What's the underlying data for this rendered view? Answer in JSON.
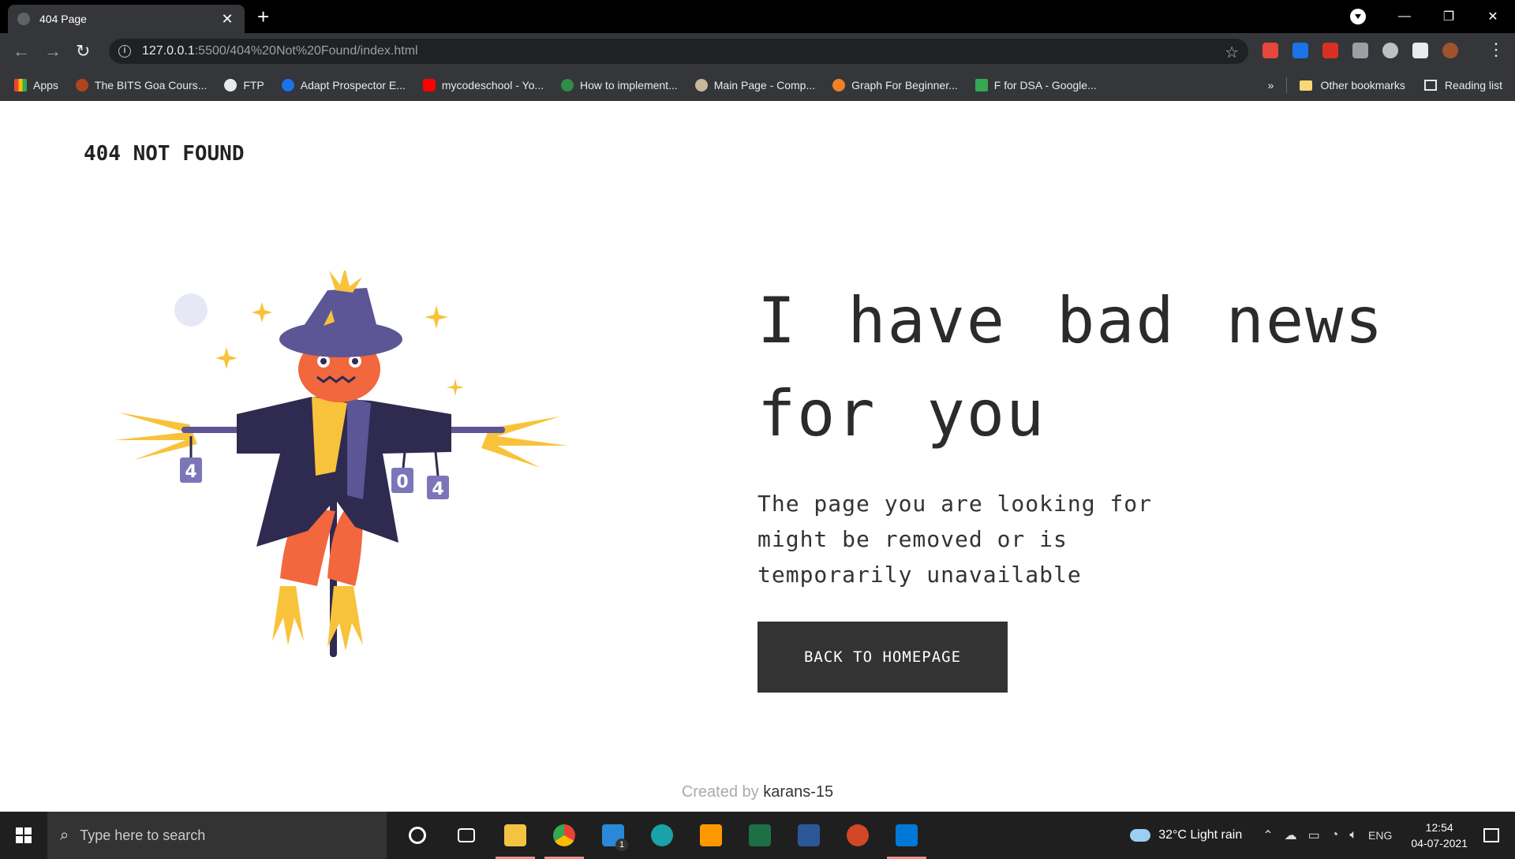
{
  "browser": {
    "tab_title": "404 Page",
    "tab_close": "✕",
    "new_tab": "+",
    "url_host": "127.0.0.1",
    "url_path": ":5500/404%20Not%20Found/index.html",
    "bookmarks": [
      {
        "label": "Apps",
        "color": "#ea4335"
      },
      {
        "label": "The BITS Goa Cours...",
        "color": "#b0441f"
      },
      {
        "label": "FTP",
        "color": "#e8eaed"
      },
      {
        "label": "Adapt Prospector E...",
        "color": "#1a73e8"
      },
      {
        "label": "mycodeschool - Yo...",
        "color": "#ff0000"
      },
      {
        "label": "How to implement...",
        "color": "#2f8d46"
      },
      {
        "label": "Main Page - Comp...",
        "color": "#c9b79c"
      },
      {
        "label": "Graph For Beginner...",
        "color": "#f48024"
      },
      {
        "label": "F for DSA - Google...",
        "color": "#34a853"
      }
    ],
    "more_bookmarks": "»",
    "other_bookmarks": "Other bookmarks",
    "reading_list": "Reading list"
  },
  "page": {
    "brand": "404 NOT FOUND",
    "headline": "I have bad news for you",
    "subtext": "The page you are looking for might be removed or is temporarily unavailable",
    "button": "BACK TO HOMEPAGE",
    "footer_prefix": "Created by",
    "footer_author": "karans-15",
    "illustration_digits": [
      "4",
      "0",
      "4"
    ]
  },
  "taskbar": {
    "search_placeholder": "Type here to search",
    "weather": "32°C  Light rain",
    "language": "ENG",
    "time": "12:54",
    "date": "04-07-2021",
    "apps": [
      {
        "name": "cortana-icon",
        "color": "transparent"
      },
      {
        "name": "task-view-icon",
        "color": "transparent"
      },
      {
        "name": "file-explorer-icon",
        "color": "#f5c342"
      },
      {
        "name": "chrome-icon",
        "color": "#4285f4"
      },
      {
        "name": "mail-icon",
        "color": "#2b88d8"
      },
      {
        "name": "edge-icon",
        "color": "#1ba2a8"
      },
      {
        "name": "sublime-icon",
        "color": "#ff9800"
      },
      {
        "name": "excel-icon",
        "color": "#1d7044"
      },
      {
        "name": "word-icon",
        "color": "#2b5797"
      },
      {
        "name": "powerpoint-icon",
        "color": "#d24726"
      },
      {
        "name": "vscode-icon",
        "color": "#0078d7"
      }
    ],
    "mail_badge": "1"
  },
  "colors": {
    "accent_dark": "#333333",
    "scarecrow_purple": "#2f2a4f",
    "hat_purple": "#5c5596",
    "pumpkin": "#f2673d",
    "straw": "#f8c33a"
  }
}
